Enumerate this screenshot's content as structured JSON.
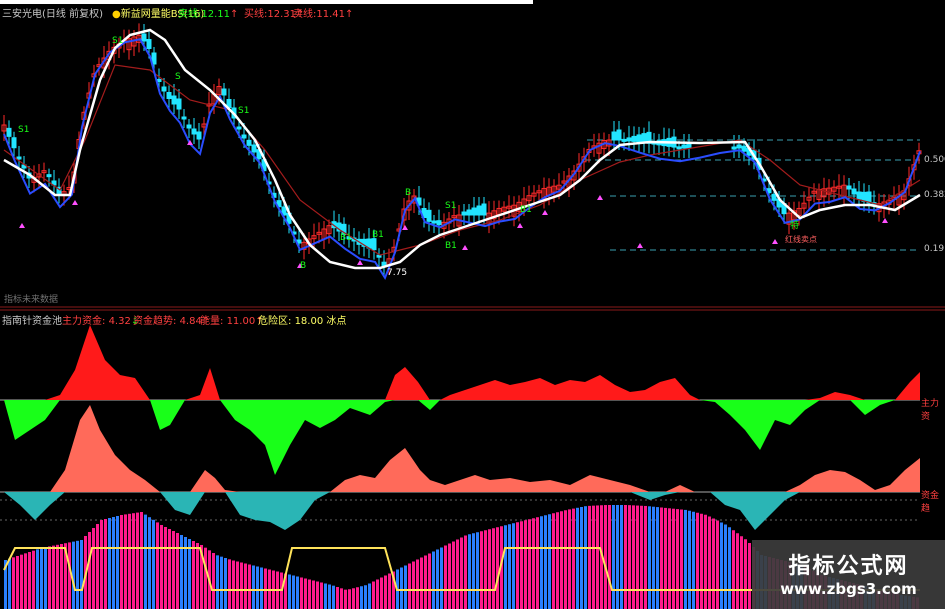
{
  "main_header": {
    "stock_name": "三安光电(日线 前复权)",
    "indicator": "新益网量能BS(16)",
    "items": [
      {
        "label": "卖线",
        "value": "12.11",
        "arrow": "↑"
      },
      {
        "label": "买线",
        "value": "12.31",
        "arrow": "↑"
      },
      {
        "label": "卖线",
        "value": "11.41",
        "arrow": "↑"
      }
    ]
  },
  "right_axis": [
    "0.500",
    "0.382",
    "0.191"
  ],
  "price_labels": [
    "S1",
    "S1",
    "S1",
    "S1",
    "B1",
    "B1",
    "B1",
    "B1",
    "S",
    "B",
    "B",
    "特"
  ],
  "low_label": "7.75",
  "small_marker_label": "红线卖点",
  "separator_text": "指标未来数据",
  "sub_header": {
    "name": "指南针资金池",
    "items": [
      {
        "label": "主力资金",
        "value": "4.32",
        "arrow": "↓"
      },
      {
        "label": "资金趋势",
        "value": "4.84",
        "arrow": "↑"
      },
      {
        "label": "能量",
        "value": "11.00",
        "arrow": "↑"
      },
      {
        "label": "危险区",
        "value": "18.00",
        "extra": "冰点"
      }
    ]
  },
  "sub_axis": [
    "主力资",
    "资金趋"
  ],
  "watermark": {
    "title": "指标公式网",
    "url": "www.zbgs3.com"
  },
  "colors": {
    "up": "#ff2a2a",
    "down": "#22e5ff",
    "ma_white": "#ffffff",
    "ma_blue": "#2a4dff",
    "ma_darkred": "#a31c1c",
    "fund_pos": "#ff1a1a",
    "fund_neg": "#19ff19",
    "trend_pos": "#ff6a5a",
    "trend_neg": "#2ab5b5",
    "bar_pink": "#ff1a8c",
    "bar_blue": "#2a7fff",
    "yellow_line": "#ffe35a",
    "header_text": "#c8c8c8"
  }
}
